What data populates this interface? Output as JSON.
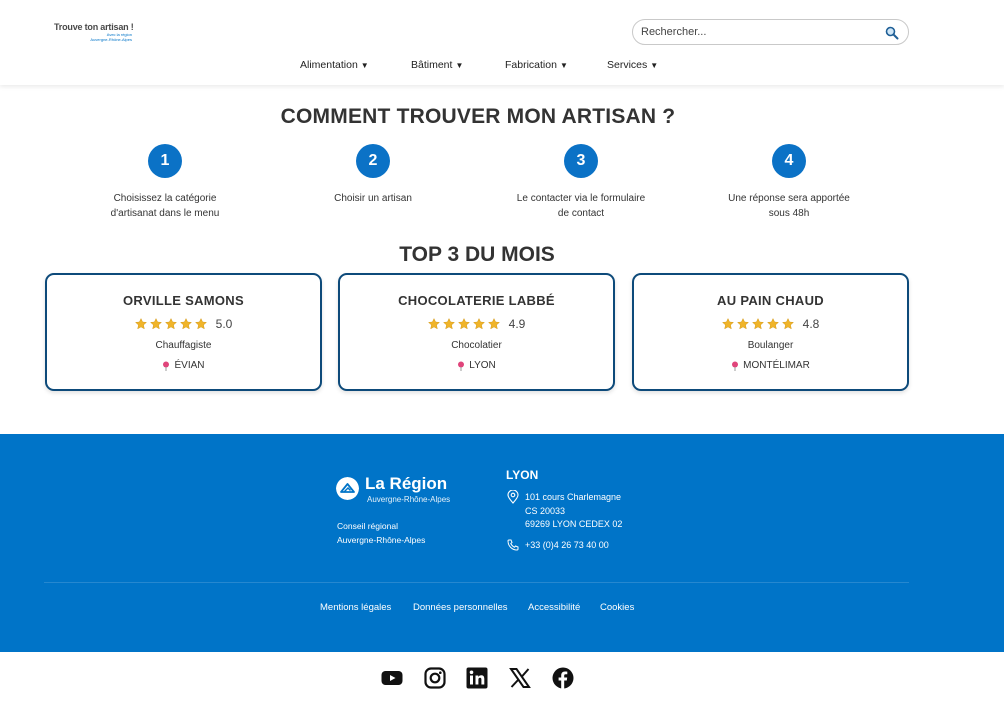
{
  "header": {
    "logo_main": "Trouve ton artisan !",
    "logo_sub_1": "Avec la région",
    "logo_sub_2": "Auvergne-Rhône-Alpes",
    "search_placeholder": "Rechercher...",
    "nav": [
      {
        "label": "Alimentation"
      },
      {
        "label": "Bâtiment"
      },
      {
        "label": "Fabrication"
      },
      {
        "label": "Services"
      }
    ]
  },
  "how": {
    "title": "COMMENT TROUVER MON ARTISAN ?",
    "steps": [
      {
        "number": "1",
        "line1": "Choisissez la catégorie",
        "line2": "d'artisanat dans le menu"
      },
      {
        "number": "2",
        "line1": "Choisir un artisan",
        "line2": ""
      },
      {
        "number": "3",
        "line1": "Le contacter via le formulaire",
        "line2": "de contact"
      },
      {
        "number": "4",
        "line1": "Une réponse sera apportée",
        "line2": "sous 48h"
      }
    ]
  },
  "top": {
    "title": "TOP 3 DU MOIS",
    "cards": [
      {
        "name": "ORVILLE SAMONS",
        "rating": "5.0",
        "stars": 5,
        "trade": "Chauffagiste",
        "city": "ÉVIAN"
      },
      {
        "name": "CHOCOLATERIE LABBÉ",
        "rating": "4.9",
        "stars": 5,
        "trade": "Chocolatier",
        "city": "LYON"
      },
      {
        "name": "AU PAIN CHAUD",
        "rating": "4.8",
        "stars": 5,
        "trade": "Boulanger",
        "city": "MONTÉLIMAR"
      }
    ]
  },
  "footer": {
    "region_name": "La Région",
    "region_sub": "Auvergne-Rhône-Alpes",
    "council_1": "Conseil régional",
    "council_2": "Auvergne-Rhône-Alpes",
    "city": "LYON",
    "address_1": "101 cours Charlemagne",
    "address_2": "CS 20033",
    "address_3": "69269 LYON CEDEX 02",
    "phone": "+33 (0)4 26 73 40 00",
    "links": [
      {
        "label": "Mentions légales"
      },
      {
        "label": "Données personnelles"
      },
      {
        "label": "Accessibilité"
      },
      {
        "label": "Cookies"
      }
    ]
  },
  "social": [
    "youtube-icon",
    "instagram-icon",
    "linkedin-icon",
    "x-icon",
    "facebook-icon"
  ],
  "colors": {
    "primary": "#0074c8",
    "card_border": "#0d4a7a",
    "star": "#f0b429",
    "pin": "#e0457b"
  }
}
